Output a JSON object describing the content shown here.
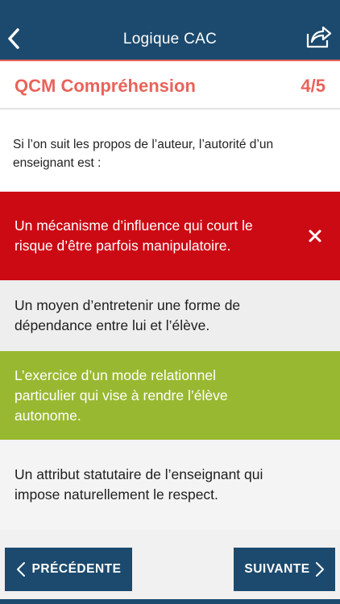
{
  "navbar": {
    "title": "Logique CAC",
    "back_icon": "chevron-left-icon",
    "share_icon": "share-icon"
  },
  "quiz": {
    "title": "QCM Compréhension",
    "progress": "4/5",
    "question": "Si l’on suit les propos de l’auteur, l’autorité d’un enseignant est :"
  },
  "answers": [
    {
      "text": "Un mécanisme d’influence qui court le risque d’être parfois manipulatoire.",
      "state": "wrong",
      "icon": "close-icon"
    },
    {
      "text": "Un moyen d’entretenir une forme de dépendance entre lui et l’élève.",
      "state": "neutral"
    },
    {
      "text": "L’exercice d’un mode relationnel particulier qui vise à rendre l’élève autonome.",
      "state": "correct"
    },
    {
      "text": "Un attribut statutaire de l’enseignant qui impose naturellement le respect.",
      "state": "neutral"
    }
  ],
  "footer": {
    "prev_label": "PRÉCÉDENTE",
    "next_label": "SUIVANTE"
  },
  "colors": {
    "primary": "#1c4a6e",
    "accent": "#e8635a",
    "wrong": "#cc0a14",
    "correct": "#99b831"
  }
}
